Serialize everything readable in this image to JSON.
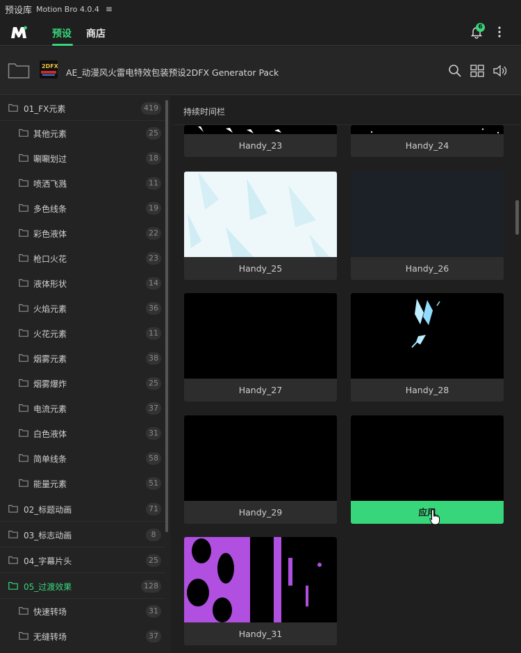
{
  "titlebar": {
    "title": "预设库",
    "subtitle": "Motion Bro 4.0.4",
    "menu_icon": "hamburger-icon"
  },
  "nav": {
    "tab_presets": "预设",
    "tab_store": "商店",
    "notification_count": "6"
  },
  "pack": {
    "title": "AE_动漫风火雷电特效包装预设2DFX Generator Pack",
    "thumb_text": "2DFX"
  },
  "sidebar": {
    "items": [
      {
        "label": "01_FX元素",
        "count": "419",
        "level": 0,
        "selected": false
      },
      {
        "label": "其他元素",
        "count": "25",
        "level": 1,
        "selected": false
      },
      {
        "label": "唰唰划过",
        "count": "18",
        "level": 1,
        "selected": false
      },
      {
        "label": "喷洒飞溅",
        "count": "11",
        "level": 1,
        "selected": false
      },
      {
        "label": "多色线条",
        "count": "19",
        "level": 1,
        "selected": false
      },
      {
        "label": "彩色液体",
        "count": "22",
        "level": 1,
        "selected": false
      },
      {
        "label": "枪口火花",
        "count": "23",
        "level": 1,
        "selected": false
      },
      {
        "label": "液体形状",
        "count": "14",
        "level": 1,
        "selected": false
      },
      {
        "label": "火焰元素",
        "count": "36",
        "level": 1,
        "selected": false
      },
      {
        "label": "火花元素",
        "count": "11",
        "level": 1,
        "selected": false
      },
      {
        "label": "烟雾元素",
        "count": "38",
        "level": 1,
        "selected": false
      },
      {
        "label": "烟雾爆炸",
        "count": "25",
        "level": 1,
        "selected": false
      },
      {
        "label": "电流元素",
        "count": "37",
        "level": 1,
        "selected": false
      },
      {
        "label": "白色液体",
        "count": "31",
        "level": 1,
        "selected": false
      },
      {
        "label": "简单线条",
        "count": "58",
        "level": 1,
        "selected": false
      },
      {
        "label": "能量元素",
        "count": "51",
        "level": 1,
        "selected": false
      },
      {
        "label": "02_标题动画",
        "count": "71",
        "level": 0,
        "selected": false
      },
      {
        "label": "03_标志动画",
        "count": "8",
        "level": 0,
        "selected": false
      },
      {
        "label": "04_字幕片头",
        "count": "25",
        "level": 0,
        "selected": false
      },
      {
        "label": "05_过渡效果",
        "count": "128",
        "level": 0,
        "selected": true
      },
      {
        "label": "快速转场",
        "count": "31",
        "level": 1,
        "selected": false
      },
      {
        "label": "无缝转场",
        "count": "37",
        "level": 1,
        "selected": false
      }
    ]
  },
  "content": {
    "header": "持续时间栏",
    "cards": [
      {
        "name": "Handy_23",
        "thumb": "sparks-bottom"
      },
      {
        "name": "Handy_24",
        "thumb": "dots-bottom"
      },
      {
        "name": "Handy_25",
        "thumb": "white-burst"
      },
      {
        "name": "Handy_26",
        "thumb": "dark-slate"
      },
      {
        "name": "Handy_27",
        "thumb": "black"
      },
      {
        "name": "Handy_28",
        "thumb": "blue-lightning"
      },
      {
        "name": "Handy_29",
        "thumb": "black"
      },
      {
        "name": "应用",
        "thumb": "black",
        "apply": true
      },
      {
        "name": "Handy_31",
        "thumb": "purple-liquid"
      }
    ]
  },
  "colors": {
    "accent": "#37d67a",
    "background": "#1f1f1f",
    "sidebar": "#232323",
    "card_label": "#2d2d2d"
  }
}
